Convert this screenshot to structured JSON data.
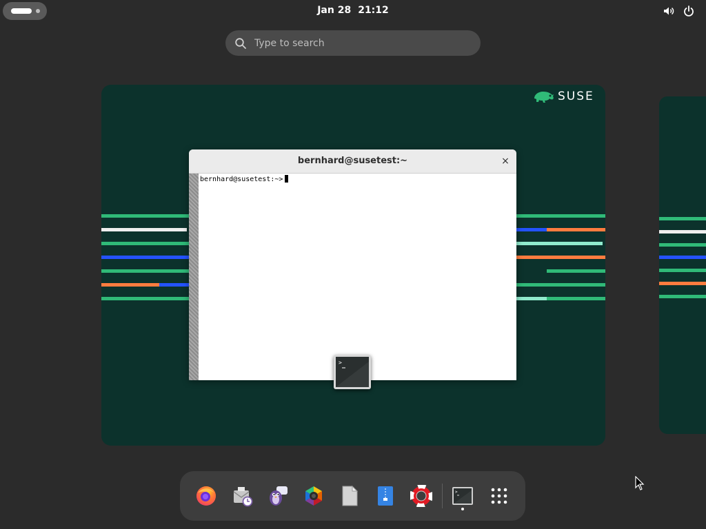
{
  "topbar": {
    "date": "Jan 28",
    "time": "21:12",
    "icons": [
      "activities-indicator",
      "volume-icon",
      "power-icon"
    ]
  },
  "search": {
    "placeholder": "Type to search",
    "icon": "search-icon"
  },
  "workspace": {
    "logo_text": "SUSE",
    "colors": {
      "background": "#0c322c",
      "green": "#30ba78",
      "blue": "#2453ff",
      "orange": "#fe7c3f",
      "mint": "#90ebcd",
      "white": "#efefef"
    }
  },
  "terminal_window": {
    "title": "bernhard@susetest:~",
    "close_label": "×",
    "prompt": "bernhard@susetest:~>"
  },
  "dock": {
    "apps": [
      "firefox-icon",
      "evolution-icon",
      "pidgin-icon",
      "shotwell-icon",
      "libreoffice-icon",
      "file-roller-icon",
      "help-icon",
      "terminal-icon",
      "app-grid-icon"
    ]
  }
}
